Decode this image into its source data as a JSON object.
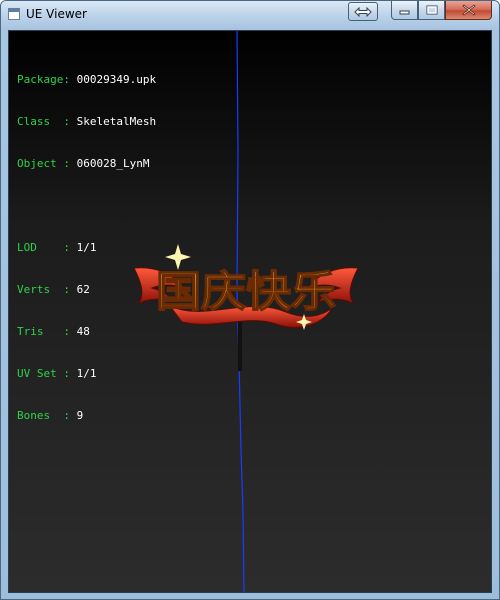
{
  "window": {
    "title": "UE Viewer",
    "icon": "app-icon",
    "controls": {
      "resize_icon": "double-arrow-icon",
      "minimize_icon": "minimize-icon",
      "maximize_icon": "maximize-icon",
      "close_icon": "close-icon"
    }
  },
  "info": {
    "package_label": "Package:",
    "package_value": "00029349.upk",
    "class_label": "Class  :",
    "class_value": "SkeletalMesh",
    "object_label": "Object :",
    "object_value": "060028_LynM",
    "lod_label": "LOD    :",
    "lod_value": "1/1",
    "verts_label": "Verts  :",
    "verts_value": "62",
    "tris_label": "Tris   :",
    "tris_value": "48",
    "uvset_label": "UV Set :",
    "uvset_value": "1/1",
    "bones_label": "Bones  :",
    "bones_value": "9"
  },
  "scene": {
    "logo_text": "国庆快乐",
    "colors": {
      "label": "#2fd24a",
      "value": "#ffffff",
      "axis": "#1a3cff",
      "logo_gold": "#f2b21e",
      "logo_red": "#c6221a"
    }
  }
}
